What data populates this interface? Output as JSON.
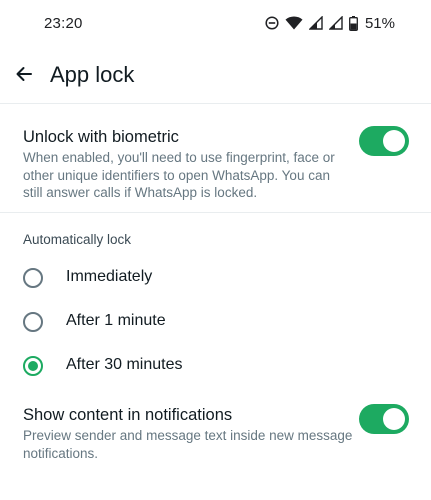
{
  "status_bar": {
    "time": "23:20",
    "battery": "51%",
    "icons": [
      "do-not-disturb-icon",
      "wifi-icon",
      "signal-icon",
      "signal-icon",
      "battery-icon"
    ]
  },
  "header": {
    "back_icon": "arrow-left-icon",
    "title": "App lock"
  },
  "biometric": {
    "title": "Unlock with biometric",
    "description": "When enabled, you'll need to use fingerprint, face or other unique identifiers to open WhatsApp. You can still answer calls if WhatsApp is locked.",
    "enabled": true
  },
  "auto_lock": {
    "header": "Automatically lock",
    "options": [
      {
        "label": "Immediately",
        "selected": false
      },
      {
        "label": "After 1 minute",
        "selected": false
      },
      {
        "label": "After 30 minutes",
        "selected": true
      }
    ]
  },
  "notifications": {
    "title": "Show content in notifications",
    "description": "Preview sender and message text inside new message notifications.",
    "enabled": true
  },
  "colors": {
    "accent": "#1daa61",
    "primary_text": "#111b21",
    "secondary_text": "#667781"
  }
}
